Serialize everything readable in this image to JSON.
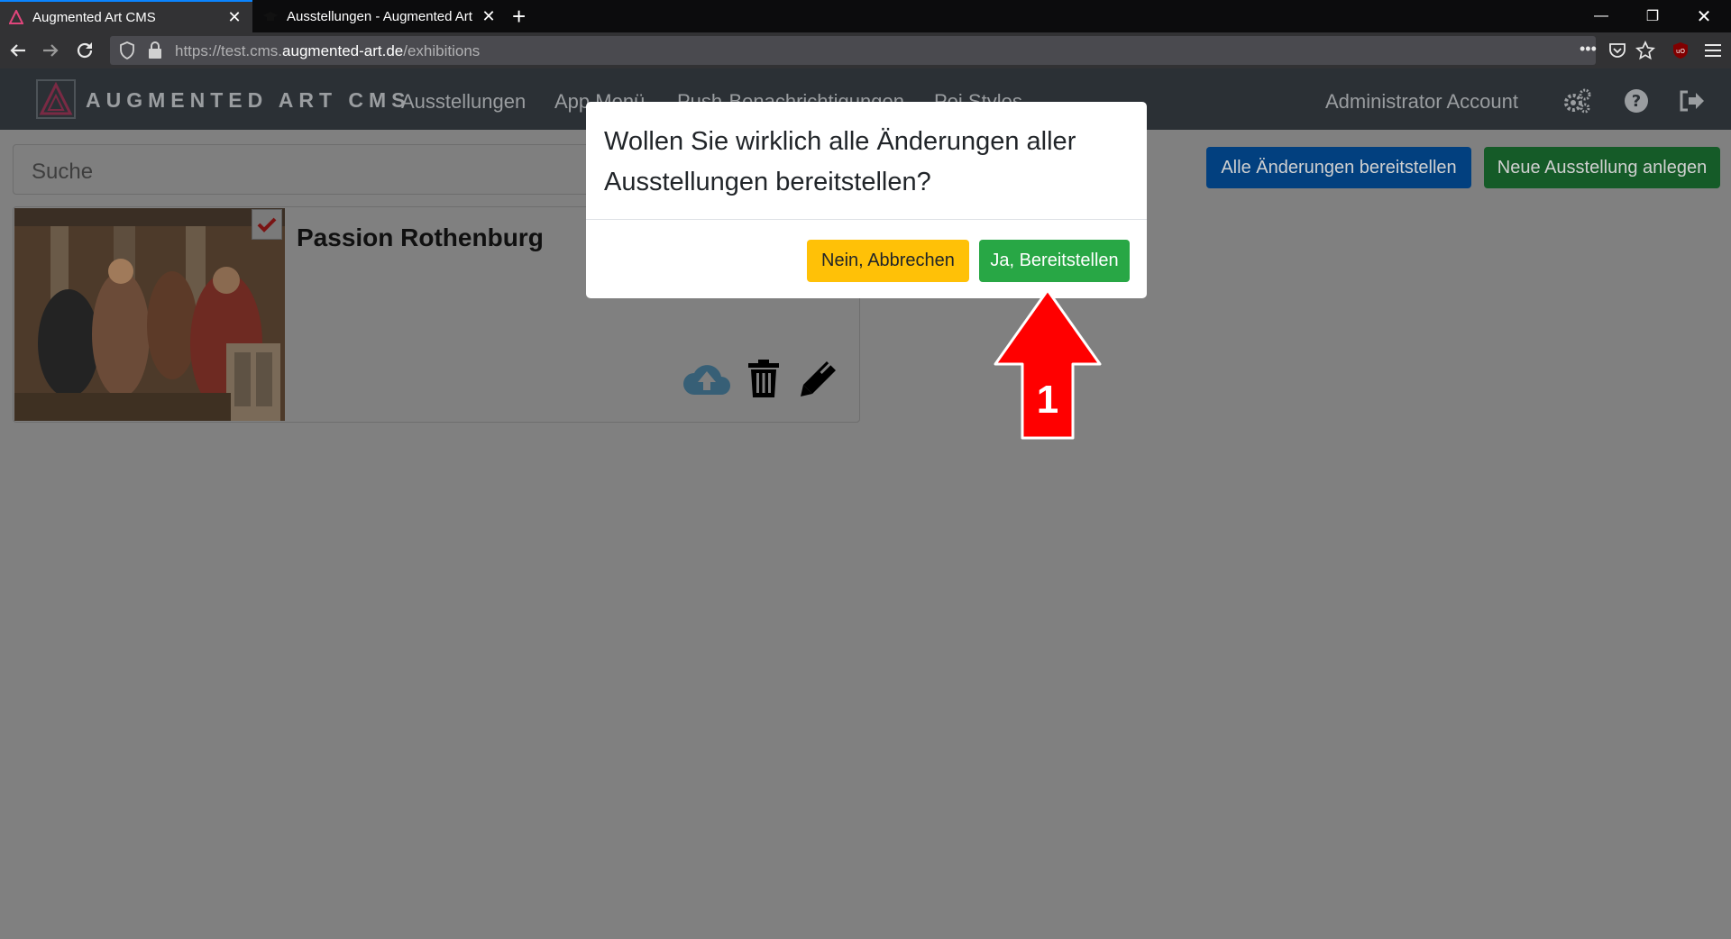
{
  "browser": {
    "tabs": [
      {
        "title": "Augmented Art CMS",
        "active": true
      },
      {
        "title": "Ausstellungen - Augmented Art",
        "active": false
      }
    ],
    "url_prefix": "https://test.cms.",
    "url_domain": "augmented-art.de",
    "url_path": "/exhibitions",
    "url_more": "•••"
  },
  "app": {
    "brand": "AUGMENTED ART CMS",
    "nav": {
      "ausstellungen": "Ausstellungen",
      "app_menu": "App Menü",
      "push": "Push-Benachrichtigungen",
      "poi": "Poi Styles",
      "account": "Administrator Account"
    },
    "search_placeholder": "Suche",
    "buttons": {
      "deploy_all": "Alle Änderungen bereitstellen",
      "new_exhibition": "Neue Ausstellung anlegen"
    },
    "exhibition": {
      "title": "Passion Rothenburg"
    }
  },
  "modal": {
    "question": "Wollen Sie wirklich alle Änderungen aller Ausstellungen bereitstellen?",
    "cancel": "Nein, Abbrechen",
    "confirm": "Ja, Bereitstellen"
  },
  "annotation": {
    "number": "1"
  },
  "colors": {
    "overlay": "#808080",
    "confirm": "#28a745",
    "cancel": "#ffc107",
    "arrow": "#ff0000",
    "appnav": "#2b3035"
  }
}
